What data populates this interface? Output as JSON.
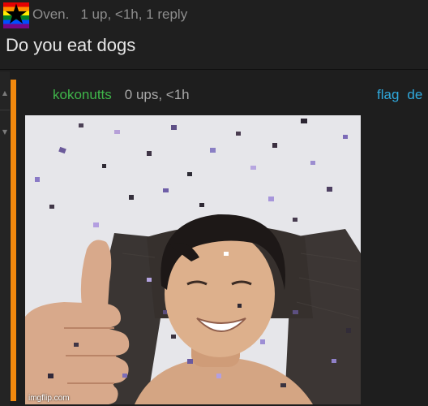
{
  "top_comment": {
    "username": "Oven.",
    "stats": "1 up, <1h, 1 reply",
    "text": "Do you eat dogs",
    "avatar_icon": "rainbow-star-icon",
    "colors": {
      "username": "#8d8d8d",
      "text": "#e6e6e6"
    }
  },
  "reply": {
    "username": "kokonutts",
    "stats": "0 ups, <1h",
    "actions": {
      "flag": "flag",
      "delete": "de"
    },
    "upvote_icon": "up-arrow-icon",
    "downvote_icon": "down-arrow-icon",
    "image": {
      "description_icon": "meme-image",
      "watermark": "imgflip.com"
    },
    "colors": {
      "username": "#3fb54a",
      "actions": "#2fa9dd",
      "thread_bar": "#f2880d"
    }
  }
}
